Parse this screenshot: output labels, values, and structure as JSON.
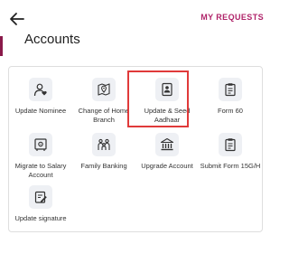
{
  "header": {
    "back_icon": "arrow-left-icon",
    "my_requests_label": "MY REQUESTS",
    "title": "Accounts"
  },
  "services": [
    {
      "label": "Update Nominee",
      "icon": "person-heart-icon"
    },
    {
      "label": "Change of Home Branch",
      "icon": "map-pin-icon"
    },
    {
      "label": "Update & Seed Aadhaar",
      "icon": "id-card-icon"
    },
    {
      "label": "Form 60",
      "icon": "clipboard-icon"
    },
    {
      "label": "Migrate to Salary Account",
      "icon": "safe-icon"
    },
    {
      "label": "Family Banking",
      "icon": "family-icon"
    },
    {
      "label": "Upgrade Account",
      "icon": "bank-icon"
    },
    {
      "label": "Submit Form 15G/H",
      "icon": "form-icon"
    },
    {
      "label": "Update signature",
      "icon": "signature-icon"
    }
  ],
  "highlighted_service": "Update & Seed Aadhaar",
  "colors": {
    "accent": "#b0246a",
    "header_accent": "#8a1a4a",
    "icon_bg": "#eef0f4",
    "highlight_border": "#e03a3a"
  }
}
